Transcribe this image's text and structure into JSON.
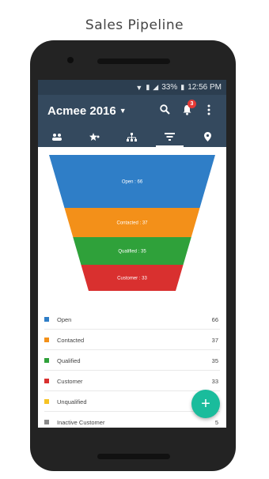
{
  "caption": "Sales Pipeline",
  "status_bar": {
    "battery": "33%",
    "time": "12:56 PM"
  },
  "app_bar": {
    "title": "Acmee 2016",
    "notification_count": "3"
  },
  "tabs": [
    {
      "icon": "team-icon"
    },
    {
      "icon": "star-person-icon"
    },
    {
      "icon": "hierarchy-icon"
    },
    {
      "icon": "funnel-filter-icon"
    },
    {
      "icon": "location-pin-icon"
    }
  ],
  "chart_data": {
    "type": "funnel",
    "stages": [
      {
        "label": "Open : 66",
        "name": "Open",
        "value": 66,
        "color": "#2f7ec7"
      },
      {
        "label": "Contacted : 37",
        "name": "Contacted",
        "value": 37,
        "color": "#f39019"
      },
      {
        "label": "Qualified : 35",
        "name": "Qualified",
        "value": 35,
        "color": "#2fa13a"
      },
      {
        "label": "Customer : 33",
        "name": "Customer",
        "value": 33,
        "color": "#d9302f"
      }
    ]
  },
  "legend": [
    {
      "name": "Open",
      "value": "66",
      "color": "#2f7ec7"
    },
    {
      "name": "Contacted",
      "value": "37",
      "color": "#f39019"
    },
    {
      "name": "Qualified",
      "value": "35",
      "color": "#2fa13a"
    },
    {
      "name": "Customer",
      "value": "33",
      "color": "#d9302f"
    },
    {
      "name": "Unqualified",
      "value": "",
      "color": "#f6c324"
    },
    {
      "name": "Inactive Customer",
      "value": "5",
      "color": "#8a8a8a"
    }
  ],
  "fab_label": "+"
}
